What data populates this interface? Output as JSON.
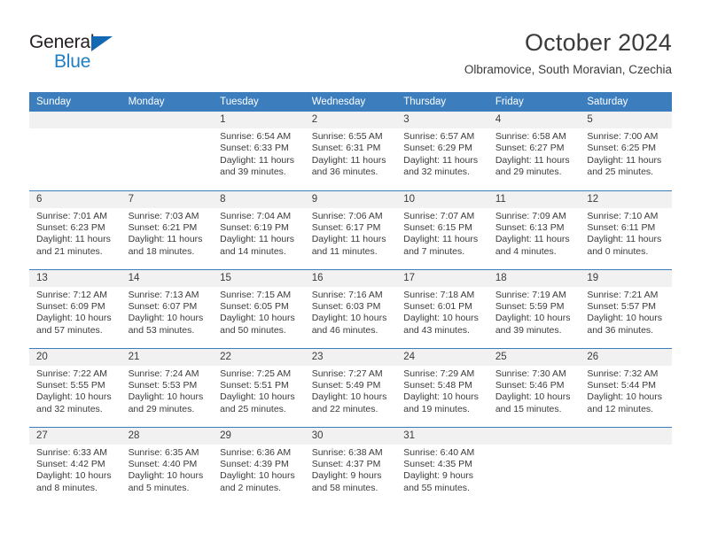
{
  "branding": {
    "logo_primary": "General",
    "logo_secondary": "Blue",
    "logo_primary_color": "#231f20",
    "logo_secondary_color": "#1f7ec4",
    "logo_triangle_color": "#1268b3"
  },
  "header": {
    "title": "October 2024",
    "subtitle": "Olbramovice, South Moravian, Czechia"
  },
  "theme": {
    "header_row_bg": "#3b7dbd",
    "header_row_text": "#ffffff",
    "daynum_bg": "#f1f1f1",
    "cell_bg": "#ffffff",
    "row_divider": "#3b7dbd",
    "body_text": "#3b3b3b"
  },
  "calendar": {
    "weekday_headers": [
      "Sunday",
      "Monday",
      "Tuesday",
      "Wednesday",
      "Thursday",
      "Friday",
      "Saturday"
    ],
    "weeks": [
      [
        {
          "day": "",
          "sunrise": "",
          "sunset": "",
          "daylight_line1": "",
          "daylight_line2": ""
        },
        {
          "day": "",
          "sunrise": "",
          "sunset": "",
          "daylight_line1": "",
          "daylight_line2": ""
        },
        {
          "day": "1",
          "sunrise": "Sunrise: 6:54 AM",
          "sunset": "Sunset: 6:33 PM",
          "daylight_line1": "Daylight: 11 hours",
          "daylight_line2": "and 39 minutes."
        },
        {
          "day": "2",
          "sunrise": "Sunrise: 6:55 AM",
          "sunset": "Sunset: 6:31 PM",
          "daylight_line1": "Daylight: 11 hours",
          "daylight_line2": "and 36 minutes."
        },
        {
          "day": "3",
          "sunrise": "Sunrise: 6:57 AM",
          "sunset": "Sunset: 6:29 PM",
          "daylight_line1": "Daylight: 11 hours",
          "daylight_line2": "and 32 minutes."
        },
        {
          "day": "4",
          "sunrise": "Sunrise: 6:58 AM",
          "sunset": "Sunset: 6:27 PM",
          "daylight_line1": "Daylight: 11 hours",
          "daylight_line2": "and 29 minutes."
        },
        {
          "day": "5",
          "sunrise": "Sunrise: 7:00 AM",
          "sunset": "Sunset: 6:25 PM",
          "daylight_line1": "Daylight: 11 hours",
          "daylight_line2": "and 25 minutes."
        }
      ],
      [
        {
          "day": "6",
          "sunrise": "Sunrise: 7:01 AM",
          "sunset": "Sunset: 6:23 PM",
          "daylight_line1": "Daylight: 11 hours",
          "daylight_line2": "and 21 minutes."
        },
        {
          "day": "7",
          "sunrise": "Sunrise: 7:03 AM",
          "sunset": "Sunset: 6:21 PM",
          "daylight_line1": "Daylight: 11 hours",
          "daylight_line2": "and 18 minutes."
        },
        {
          "day": "8",
          "sunrise": "Sunrise: 7:04 AM",
          "sunset": "Sunset: 6:19 PM",
          "daylight_line1": "Daylight: 11 hours",
          "daylight_line2": "and 14 minutes."
        },
        {
          "day": "9",
          "sunrise": "Sunrise: 7:06 AM",
          "sunset": "Sunset: 6:17 PM",
          "daylight_line1": "Daylight: 11 hours",
          "daylight_line2": "and 11 minutes."
        },
        {
          "day": "10",
          "sunrise": "Sunrise: 7:07 AM",
          "sunset": "Sunset: 6:15 PM",
          "daylight_line1": "Daylight: 11 hours",
          "daylight_line2": "and 7 minutes."
        },
        {
          "day": "11",
          "sunrise": "Sunrise: 7:09 AM",
          "sunset": "Sunset: 6:13 PM",
          "daylight_line1": "Daylight: 11 hours",
          "daylight_line2": "and 4 minutes."
        },
        {
          "day": "12",
          "sunrise": "Sunrise: 7:10 AM",
          "sunset": "Sunset: 6:11 PM",
          "daylight_line1": "Daylight: 11 hours",
          "daylight_line2": "and 0 minutes."
        }
      ],
      [
        {
          "day": "13",
          "sunrise": "Sunrise: 7:12 AM",
          "sunset": "Sunset: 6:09 PM",
          "daylight_line1": "Daylight: 10 hours",
          "daylight_line2": "and 57 minutes."
        },
        {
          "day": "14",
          "sunrise": "Sunrise: 7:13 AM",
          "sunset": "Sunset: 6:07 PM",
          "daylight_line1": "Daylight: 10 hours",
          "daylight_line2": "and 53 minutes."
        },
        {
          "day": "15",
          "sunrise": "Sunrise: 7:15 AM",
          "sunset": "Sunset: 6:05 PM",
          "daylight_line1": "Daylight: 10 hours",
          "daylight_line2": "and 50 minutes."
        },
        {
          "day": "16",
          "sunrise": "Sunrise: 7:16 AM",
          "sunset": "Sunset: 6:03 PM",
          "daylight_line1": "Daylight: 10 hours",
          "daylight_line2": "and 46 minutes."
        },
        {
          "day": "17",
          "sunrise": "Sunrise: 7:18 AM",
          "sunset": "Sunset: 6:01 PM",
          "daylight_line1": "Daylight: 10 hours",
          "daylight_line2": "and 43 minutes."
        },
        {
          "day": "18",
          "sunrise": "Sunrise: 7:19 AM",
          "sunset": "Sunset: 5:59 PM",
          "daylight_line1": "Daylight: 10 hours",
          "daylight_line2": "and 39 minutes."
        },
        {
          "day": "19",
          "sunrise": "Sunrise: 7:21 AM",
          "sunset": "Sunset: 5:57 PM",
          "daylight_line1": "Daylight: 10 hours",
          "daylight_line2": "and 36 minutes."
        }
      ],
      [
        {
          "day": "20",
          "sunrise": "Sunrise: 7:22 AM",
          "sunset": "Sunset: 5:55 PM",
          "daylight_line1": "Daylight: 10 hours",
          "daylight_line2": "and 32 minutes."
        },
        {
          "day": "21",
          "sunrise": "Sunrise: 7:24 AM",
          "sunset": "Sunset: 5:53 PM",
          "daylight_line1": "Daylight: 10 hours",
          "daylight_line2": "and 29 minutes."
        },
        {
          "day": "22",
          "sunrise": "Sunrise: 7:25 AM",
          "sunset": "Sunset: 5:51 PM",
          "daylight_line1": "Daylight: 10 hours",
          "daylight_line2": "and 25 minutes."
        },
        {
          "day": "23",
          "sunrise": "Sunrise: 7:27 AM",
          "sunset": "Sunset: 5:49 PM",
          "daylight_line1": "Daylight: 10 hours",
          "daylight_line2": "and 22 minutes."
        },
        {
          "day": "24",
          "sunrise": "Sunrise: 7:29 AM",
          "sunset": "Sunset: 5:48 PM",
          "daylight_line1": "Daylight: 10 hours",
          "daylight_line2": "and 19 minutes."
        },
        {
          "day": "25",
          "sunrise": "Sunrise: 7:30 AM",
          "sunset": "Sunset: 5:46 PM",
          "daylight_line1": "Daylight: 10 hours",
          "daylight_line2": "and 15 minutes."
        },
        {
          "day": "26",
          "sunrise": "Sunrise: 7:32 AM",
          "sunset": "Sunset: 5:44 PM",
          "daylight_line1": "Daylight: 10 hours",
          "daylight_line2": "and 12 minutes."
        }
      ],
      [
        {
          "day": "27",
          "sunrise": "Sunrise: 6:33 AM",
          "sunset": "Sunset: 4:42 PM",
          "daylight_line1": "Daylight: 10 hours",
          "daylight_line2": "and 8 minutes."
        },
        {
          "day": "28",
          "sunrise": "Sunrise: 6:35 AM",
          "sunset": "Sunset: 4:40 PM",
          "daylight_line1": "Daylight: 10 hours",
          "daylight_line2": "and 5 minutes."
        },
        {
          "day": "29",
          "sunrise": "Sunrise: 6:36 AM",
          "sunset": "Sunset: 4:39 PM",
          "daylight_line1": "Daylight: 10 hours",
          "daylight_line2": "and 2 minutes."
        },
        {
          "day": "30",
          "sunrise": "Sunrise: 6:38 AM",
          "sunset": "Sunset: 4:37 PM",
          "daylight_line1": "Daylight: 9 hours",
          "daylight_line2": "and 58 minutes."
        },
        {
          "day": "31",
          "sunrise": "Sunrise: 6:40 AM",
          "sunset": "Sunset: 4:35 PM",
          "daylight_line1": "Daylight: 9 hours",
          "daylight_line2": "and 55 minutes."
        },
        {
          "day": "",
          "sunrise": "",
          "sunset": "",
          "daylight_line1": "",
          "daylight_line2": ""
        },
        {
          "day": "",
          "sunrise": "",
          "sunset": "",
          "daylight_line1": "",
          "daylight_line2": ""
        }
      ]
    ]
  }
}
